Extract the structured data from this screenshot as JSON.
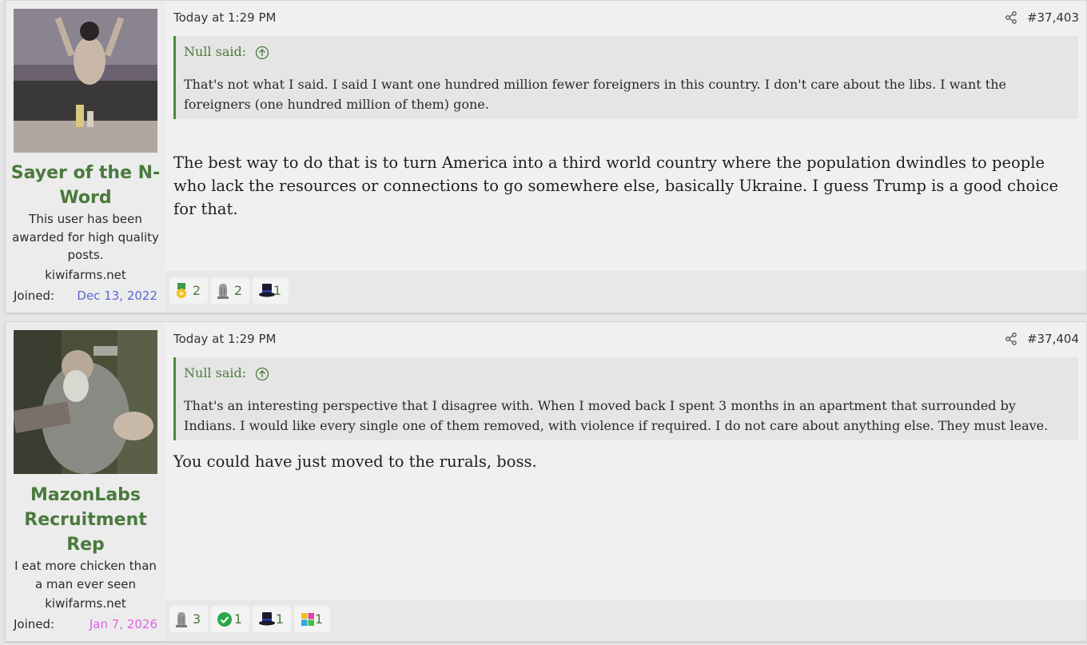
{
  "posts": [
    {
      "username": "Sayer of the N-Word",
      "user_title": "This user has been awarded for high quality posts.",
      "user_site": "kiwifarms.net",
      "joined_label": "Joined:",
      "joined_date": "Dec 13, 2022",
      "joined_color": "#5a6acf",
      "date": "Today at 1:29 PM",
      "post_number": "#37,403",
      "quote_author": "Null said:",
      "quote_text": "That's not what I said. I said I want one hundred million fewer foreigners in this country. I don't care about the libs. I want the foreigners (one hundred million of them) gone.",
      "message": "The best way to do that is to turn America into a third world country where the population dwindles to people who lack the resources or connections to go somewhere else, basically Ukraine. I guess Trump is a good choice for that.",
      "reactions": [
        {
          "icon": "medal-icon",
          "count": "2"
        },
        {
          "icon": "tombstone-icon",
          "count": "2"
        },
        {
          "icon": "top-hat-icon",
          "count": "1"
        }
      ]
    },
    {
      "username": "MazonLabs Recruitment Rep",
      "user_title": "I eat more chicken than a man ever seen",
      "user_site": "kiwifarms.net",
      "joined_label": "Joined:",
      "joined_date": "Jan 7, 2026",
      "joined_color": "#e064e0",
      "date": "Today at 1:29 PM",
      "post_number": "#37,404",
      "quote_author": "Null said:",
      "quote_text": "That's an interesting perspective that I disagree with. When I moved back I spent 3 months in an apartment that surrounded by Indians. I would like every single one of them removed, with violence if required. I do not care about anything else. They must leave.",
      "message": "You could have just moved to the rurals, boss.",
      "reactions": [
        {
          "icon": "tombstone-icon",
          "count": "3"
        },
        {
          "icon": "checkmark-icon",
          "count": "1"
        },
        {
          "icon": "top-hat-icon",
          "count": "1"
        },
        {
          "icon": "puzzle-icon",
          "count": "1"
        }
      ]
    }
  ],
  "colors": {
    "accent_green": "#4a7a3d",
    "quote_border": "#4c8a3c"
  }
}
